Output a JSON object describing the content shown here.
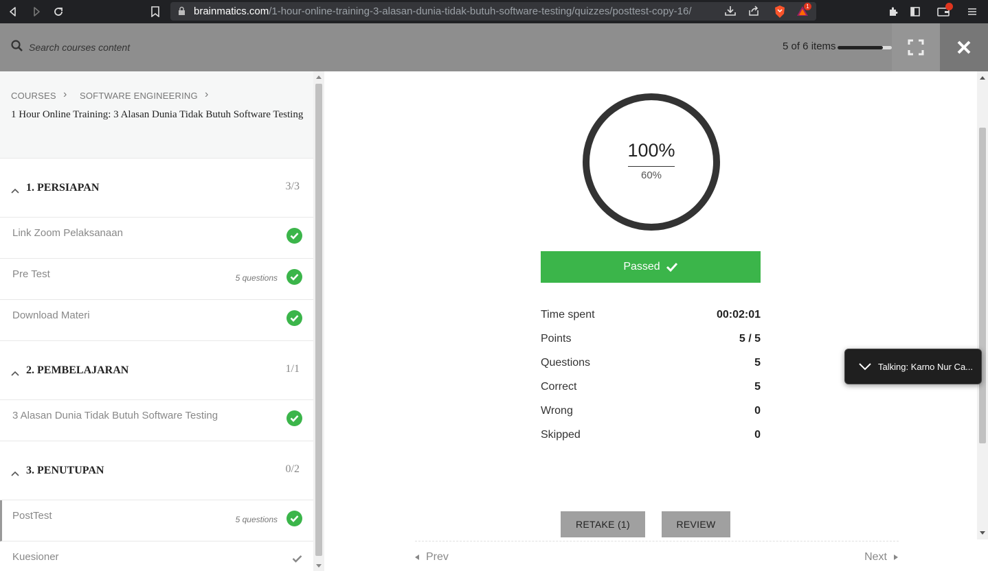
{
  "browser": {
    "url_host": "brainmatics.com",
    "url_path": "/1-hour-online-training-3-alasan-dunia-tidak-butuh-software-testing/quizzes/posttest-copy-16/",
    "brave_badge": "1",
    "icons": [
      "back-icon",
      "forward-icon",
      "reload-icon",
      "bookmark-icon",
      "lock-icon",
      "download-icon",
      "share-icon",
      "brave-shield-icon",
      "brave-rewards-icon",
      "extensions-icon",
      "sidebar-icon",
      "wallet-icon",
      "menu-icon"
    ]
  },
  "header": {
    "search_placeholder": "Search courses content",
    "progress_label": "5 of 6 items",
    "progress_fraction": 0.83
  },
  "sidebar": {
    "breadcrumb": [
      "COURSES",
      "SOFTWARE ENGINEERING"
    ],
    "course_title": "1 Hour Online Training: 3 Alasan Dunia Tidak Butuh Software Testing",
    "sections": [
      {
        "title": "1. PERSIAPAN",
        "count": "3/3",
        "items": [
          {
            "label": "Link Zoom Pelaksanaan",
            "meta": "",
            "status": "completed"
          },
          {
            "label": "Pre Test",
            "meta": "5 questions",
            "status": "completed"
          },
          {
            "label": "Download Materi",
            "meta": "",
            "status": "completed"
          }
        ]
      },
      {
        "title": "2. PEMBELAJARAN",
        "count": "1/1",
        "items": [
          {
            "label": "3 Alasan Dunia Tidak Butuh Software Testing",
            "meta": "",
            "status": "completed"
          }
        ]
      },
      {
        "title": "3. PENUTUPAN",
        "count": "0/2",
        "items": [
          {
            "label": "PostTest",
            "meta": "5 questions",
            "status": "completed"
          },
          {
            "label": "Kuesioner",
            "meta": "",
            "status": "viewed"
          }
        ]
      }
    ]
  },
  "result": {
    "score": "100%",
    "passing_grade": "60%",
    "status_label": "Passed",
    "stats": [
      {
        "label": "Time spent",
        "value": "00:02:01"
      },
      {
        "label": "Points",
        "value": "5 / 5"
      },
      {
        "label": "Questions",
        "value": "5"
      },
      {
        "label": "Correct",
        "value": "5"
      },
      {
        "label": "Wrong",
        "value": "0"
      },
      {
        "label": "Skipped",
        "value": "0"
      }
    ],
    "retake_label": "RETAKE (1)",
    "review_label": "REVIEW",
    "prev_label": "Prev",
    "next_label": "Next"
  },
  "toast": {
    "text": "Talking: Karno Nur Ca..."
  },
  "colors": {
    "success": "#3bb54a",
    "header_bg": "#8e8e8e",
    "browser_bg": "#202124"
  }
}
